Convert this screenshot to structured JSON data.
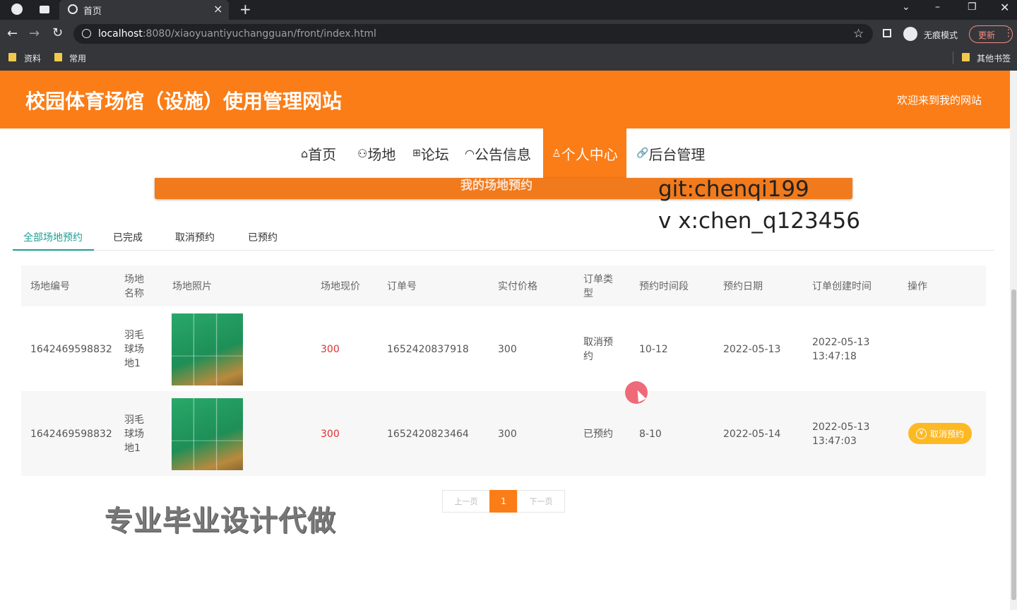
{
  "browser": {
    "tab_title": "首页",
    "tab_close": "×",
    "new_tab": "+",
    "url_host": "localhost",
    "url_rest": ":8080/xiaoyuantiyuchangguan/front/index.html",
    "incognito_label": "无痕模式",
    "update_label": "更新",
    "bookmarks": [
      "资料",
      "常用"
    ],
    "other_bookmarks": "其他书签"
  },
  "site": {
    "title": "校园体育场馆（设施）使用管理网站",
    "welcome": "欢迎来到我的网站"
  },
  "nav": [
    {
      "icon": "⌂",
      "label": "首页"
    },
    {
      "icon": "⚇",
      "label": "场地"
    },
    {
      "icon": "⊞",
      "label": "论坛"
    },
    {
      "icon": "◠",
      "label": "公告信息"
    },
    {
      "icon": "♙",
      "label": "个人中心"
    },
    {
      "icon": "🔗",
      "label": "后台管理"
    }
  ],
  "banner_title": "我的场地预约",
  "overlay": {
    "line1": "git:chenqi199",
    "line2": "v x:chen_q123456",
    "bottom": "专业毕业设计代做"
  },
  "tabs": [
    "全部场地预约",
    "已完成",
    "取消预约",
    "已预约"
  ],
  "columns": [
    "场地编号",
    "场地名称",
    "场地照片",
    "场地现价",
    "订单号",
    "实付价格",
    "订单类型",
    "预约时间段",
    "预约日期",
    "订单创建时间",
    "操作"
  ],
  "rows": [
    {
      "venue_no": "1642469598832",
      "name_lines": [
        "羽毛",
        "球场",
        "地1"
      ],
      "price": "300",
      "order_no": "1652420837918",
      "paid": "300",
      "type_lines": [
        "取消预",
        "约"
      ],
      "slot": "10-12",
      "date": "2022-05-13",
      "created_lines": [
        "2022-05-13",
        "13:47:18"
      ],
      "action": ""
    },
    {
      "venue_no": "1642469598832",
      "name_lines": [
        "羽毛",
        "球场",
        "地1"
      ],
      "price": "300",
      "order_no": "1652420823464",
      "paid": "300",
      "type_lines": [
        "已预约"
      ],
      "slot": "8-10",
      "date": "2022-05-14",
      "created_lines": [
        "2022-05-13",
        "13:47:03"
      ],
      "action": "取消预约"
    }
  ],
  "pagination": {
    "prev": "上一页",
    "current": "1",
    "next": "下一页"
  },
  "colors": {
    "brand_orange": "#fb7d17",
    "tab_active": "#1aa094",
    "price_red": "#e03030",
    "cancel_button": "#fdb924"
  }
}
